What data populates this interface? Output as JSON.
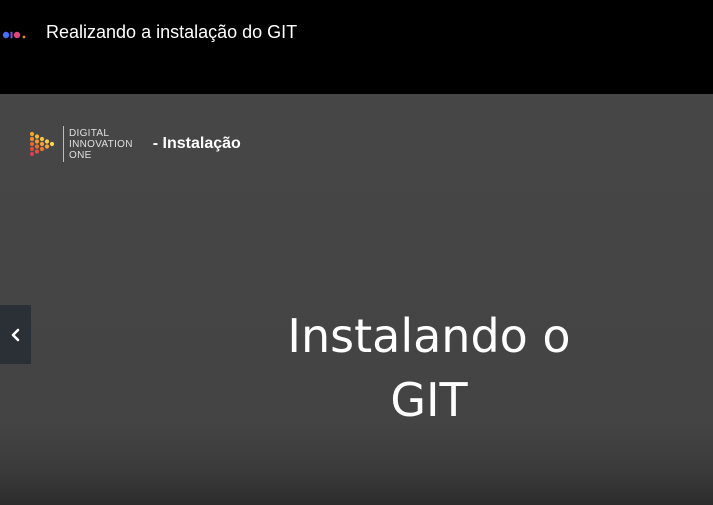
{
  "header": {
    "title": "Realizando a instalação do GIT",
    "logo_icon": "dio-logo-icon"
  },
  "slide": {
    "brand": {
      "line1": "DIGITAL",
      "line2": "INNOVATION",
      "line3": "ONE",
      "suffix": "- Instalação",
      "icon": "digital-innovation-one-hex-icon"
    },
    "heading_line1": "Instalando o",
    "heading_line2": "GIT"
  },
  "controls": {
    "prev_icon": "chevron-left-icon"
  },
  "colors": {
    "background": "#000000",
    "slide_background": "#464646",
    "prev_button": "#2b2f36"
  }
}
